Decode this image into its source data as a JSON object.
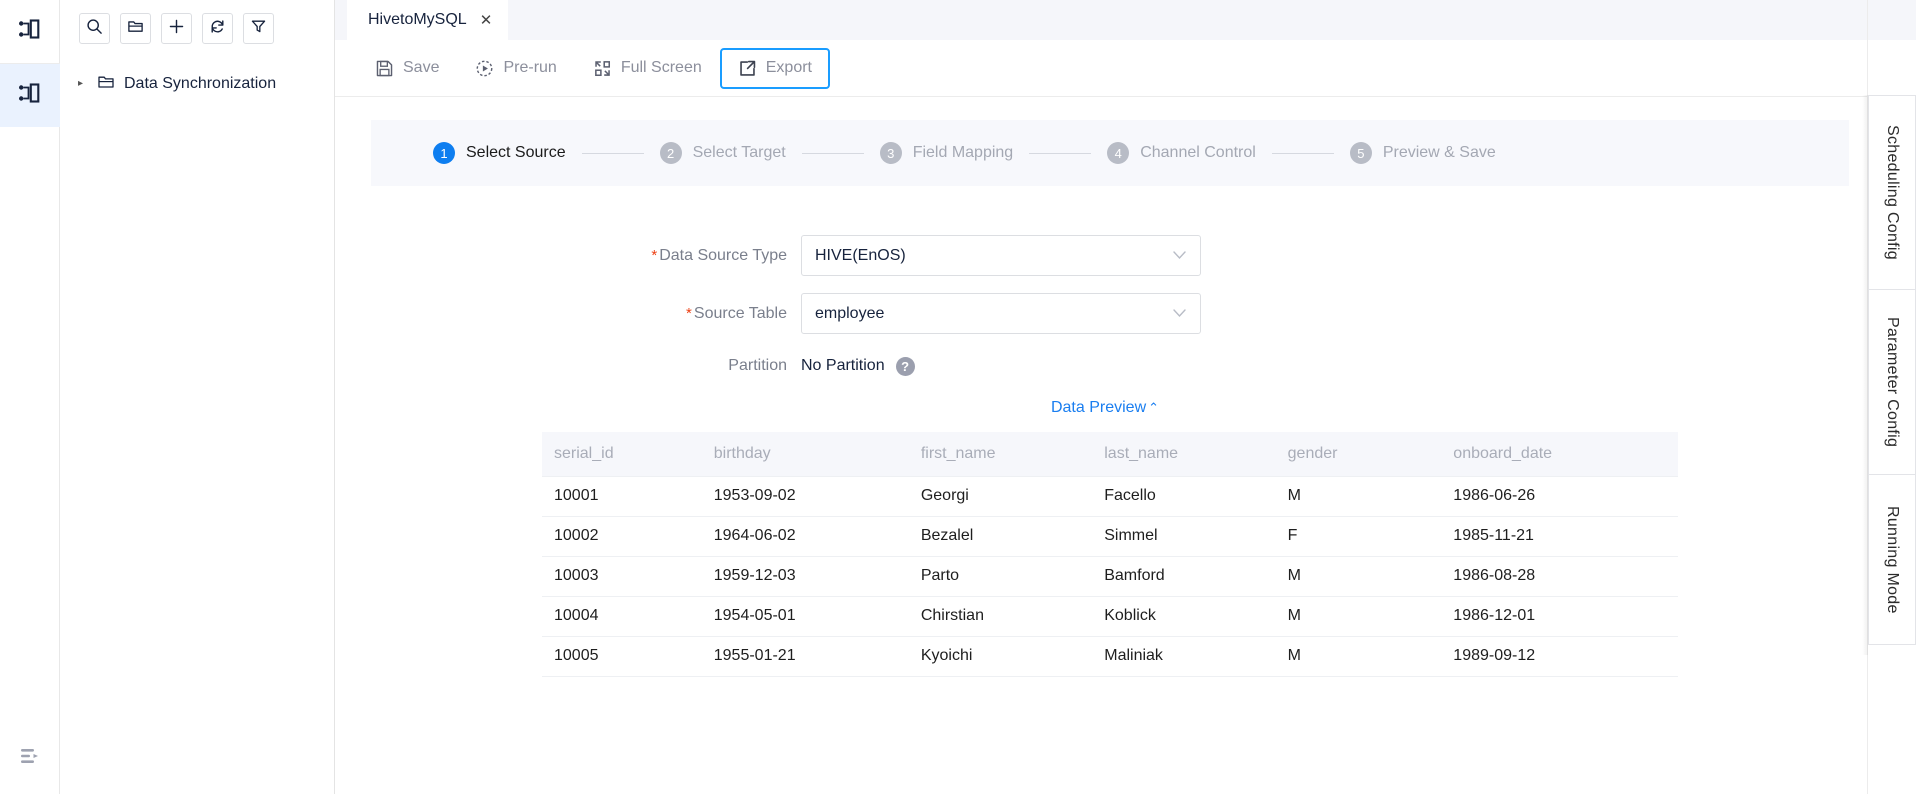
{
  "rail": {
    "items": [
      {
        "name": "workflow-icon-top",
        "active": false
      },
      {
        "name": "workflow-icon-active",
        "active": true
      }
    ],
    "collapse_label": "collapse-sidebar"
  },
  "tree": {
    "toolbar": [
      {
        "id": "search",
        "icon": "search-icon",
        "title": "Search"
      },
      {
        "id": "new-folder",
        "icon": "folder-icon",
        "title": "New Folder"
      },
      {
        "id": "add",
        "icon": "plus-icon",
        "title": "Add"
      },
      {
        "id": "refresh",
        "icon": "refresh-icon",
        "title": "Refresh"
      },
      {
        "id": "filter",
        "icon": "filter-icon",
        "title": "Filter"
      }
    ],
    "nodes": [
      {
        "label": "Data Synchronization",
        "caret": "▸",
        "icon": "folder-icon"
      }
    ]
  },
  "tabs": [
    {
      "label": "HivetoMySQL",
      "close": "✕",
      "active": true
    }
  ],
  "toolbar": {
    "actions": [
      {
        "id": "save",
        "label": "Save",
        "icon": "save-icon",
        "highlighted": false
      },
      {
        "id": "pre-run",
        "label": "Pre-run",
        "icon": "play-circle-icon",
        "highlighted": false
      },
      {
        "id": "full-screen",
        "label": "Full Screen",
        "icon": "fullscreen-icon",
        "highlighted": false
      },
      {
        "id": "export",
        "label": "Export",
        "icon": "export-icon",
        "highlighted": true
      }
    ],
    "highlight_color": "#1a9dff"
  },
  "stepper": {
    "active_index": 0,
    "active_color": "#0e7ef0",
    "inactive_color": "#b8bcc6",
    "steps": [
      {
        "num": "1",
        "label": "Select Source"
      },
      {
        "num": "2",
        "label": "Select Target"
      },
      {
        "num": "3",
        "label": "Field Mapping"
      },
      {
        "num": "4",
        "label": "Channel Control"
      },
      {
        "num": "5",
        "label": "Preview & Save"
      }
    ]
  },
  "form": {
    "fields": [
      {
        "id": "data-source-type",
        "label": "Data Source Type",
        "required": true,
        "type": "select",
        "value": "HIVE(EnOS)",
        "chevron": "⌄"
      },
      {
        "id": "source-table",
        "label": "Source Table",
        "required": true,
        "type": "select",
        "value": "employee",
        "chevron": "⌄"
      },
      {
        "id": "partition",
        "label": "Partition",
        "required": false,
        "type": "text",
        "value": "No Partition",
        "help": "?"
      }
    ]
  },
  "preview": {
    "link_label": "Data Preview",
    "link_caret": "⌃",
    "link_color": "#1a7ef0",
    "columns": [
      "serial_id",
      "birthday",
      "first_name",
      "last_name",
      "gender",
      "onboard_date"
    ],
    "rows": [
      [
        "10001",
        "1953-09-02",
        "Georgi",
        "Facello",
        "M",
        "1986-06-26"
      ],
      [
        "10002",
        "1964-06-02",
        "Bezalel",
        "Simmel",
        "F",
        "1985-11-21"
      ],
      [
        "10003",
        "1959-12-03",
        "Parto",
        "Bamford",
        "M",
        "1986-08-28"
      ],
      [
        "10004",
        "1954-05-01",
        "Chirstian",
        "Koblick",
        "M",
        "1986-12-01"
      ],
      [
        "10005",
        "1955-01-21",
        "Kyoichi",
        "Maliniak",
        "M",
        "1989-09-12"
      ]
    ]
  },
  "right_tabs": [
    {
      "label": "Scheduling Config"
    },
    {
      "label": "Parameter Config"
    },
    {
      "label": "Running Mode"
    }
  ]
}
